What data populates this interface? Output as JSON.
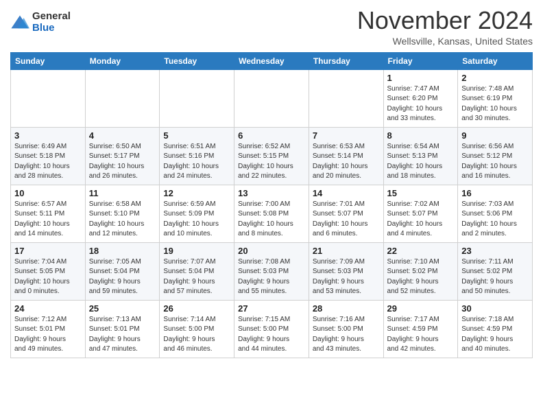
{
  "logo": {
    "general": "General",
    "blue": "Blue"
  },
  "title": "November 2024",
  "location": "Wellsville, Kansas, United States",
  "days_of_week": [
    "Sunday",
    "Monday",
    "Tuesday",
    "Wednesday",
    "Thursday",
    "Friday",
    "Saturday"
  ],
  "weeks": [
    [
      {
        "day": "",
        "info": ""
      },
      {
        "day": "",
        "info": ""
      },
      {
        "day": "",
        "info": ""
      },
      {
        "day": "",
        "info": ""
      },
      {
        "day": "",
        "info": ""
      },
      {
        "day": "1",
        "info": "Sunrise: 7:47 AM\nSunset: 6:20 PM\nDaylight: 10 hours\nand 33 minutes."
      },
      {
        "day": "2",
        "info": "Sunrise: 7:48 AM\nSunset: 6:19 PM\nDaylight: 10 hours\nand 30 minutes."
      }
    ],
    [
      {
        "day": "3",
        "info": "Sunrise: 6:49 AM\nSunset: 5:18 PM\nDaylight: 10 hours\nand 28 minutes."
      },
      {
        "day": "4",
        "info": "Sunrise: 6:50 AM\nSunset: 5:17 PM\nDaylight: 10 hours\nand 26 minutes."
      },
      {
        "day": "5",
        "info": "Sunrise: 6:51 AM\nSunset: 5:16 PM\nDaylight: 10 hours\nand 24 minutes."
      },
      {
        "day": "6",
        "info": "Sunrise: 6:52 AM\nSunset: 5:15 PM\nDaylight: 10 hours\nand 22 minutes."
      },
      {
        "day": "7",
        "info": "Sunrise: 6:53 AM\nSunset: 5:14 PM\nDaylight: 10 hours\nand 20 minutes."
      },
      {
        "day": "8",
        "info": "Sunrise: 6:54 AM\nSunset: 5:13 PM\nDaylight: 10 hours\nand 18 minutes."
      },
      {
        "day": "9",
        "info": "Sunrise: 6:56 AM\nSunset: 5:12 PM\nDaylight: 10 hours\nand 16 minutes."
      }
    ],
    [
      {
        "day": "10",
        "info": "Sunrise: 6:57 AM\nSunset: 5:11 PM\nDaylight: 10 hours\nand 14 minutes."
      },
      {
        "day": "11",
        "info": "Sunrise: 6:58 AM\nSunset: 5:10 PM\nDaylight: 10 hours\nand 12 minutes."
      },
      {
        "day": "12",
        "info": "Sunrise: 6:59 AM\nSunset: 5:09 PM\nDaylight: 10 hours\nand 10 minutes."
      },
      {
        "day": "13",
        "info": "Sunrise: 7:00 AM\nSunset: 5:08 PM\nDaylight: 10 hours\nand 8 minutes."
      },
      {
        "day": "14",
        "info": "Sunrise: 7:01 AM\nSunset: 5:07 PM\nDaylight: 10 hours\nand 6 minutes."
      },
      {
        "day": "15",
        "info": "Sunrise: 7:02 AM\nSunset: 5:07 PM\nDaylight: 10 hours\nand 4 minutes."
      },
      {
        "day": "16",
        "info": "Sunrise: 7:03 AM\nSunset: 5:06 PM\nDaylight: 10 hours\nand 2 minutes."
      }
    ],
    [
      {
        "day": "17",
        "info": "Sunrise: 7:04 AM\nSunset: 5:05 PM\nDaylight: 10 hours\nand 0 minutes."
      },
      {
        "day": "18",
        "info": "Sunrise: 7:05 AM\nSunset: 5:04 PM\nDaylight: 9 hours\nand 59 minutes."
      },
      {
        "day": "19",
        "info": "Sunrise: 7:07 AM\nSunset: 5:04 PM\nDaylight: 9 hours\nand 57 minutes."
      },
      {
        "day": "20",
        "info": "Sunrise: 7:08 AM\nSunset: 5:03 PM\nDaylight: 9 hours\nand 55 minutes."
      },
      {
        "day": "21",
        "info": "Sunrise: 7:09 AM\nSunset: 5:03 PM\nDaylight: 9 hours\nand 53 minutes."
      },
      {
        "day": "22",
        "info": "Sunrise: 7:10 AM\nSunset: 5:02 PM\nDaylight: 9 hours\nand 52 minutes."
      },
      {
        "day": "23",
        "info": "Sunrise: 7:11 AM\nSunset: 5:02 PM\nDaylight: 9 hours\nand 50 minutes."
      }
    ],
    [
      {
        "day": "24",
        "info": "Sunrise: 7:12 AM\nSunset: 5:01 PM\nDaylight: 9 hours\nand 49 minutes."
      },
      {
        "day": "25",
        "info": "Sunrise: 7:13 AM\nSunset: 5:01 PM\nDaylight: 9 hours\nand 47 minutes."
      },
      {
        "day": "26",
        "info": "Sunrise: 7:14 AM\nSunset: 5:00 PM\nDaylight: 9 hours\nand 46 minutes."
      },
      {
        "day": "27",
        "info": "Sunrise: 7:15 AM\nSunset: 5:00 PM\nDaylight: 9 hours\nand 44 minutes."
      },
      {
        "day": "28",
        "info": "Sunrise: 7:16 AM\nSunset: 5:00 PM\nDaylight: 9 hours\nand 43 minutes."
      },
      {
        "day": "29",
        "info": "Sunrise: 7:17 AM\nSunset: 4:59 PM\nDaylight: 9 hours\nand 42 minutes."
      },
      {
        "day": "30",
        "info": "Sunrise: 7:18 AM\nSunset: 4:59 PM\nDaylight: 9 hours\nand 40 minutes."
      }
    ]
  ]
}
